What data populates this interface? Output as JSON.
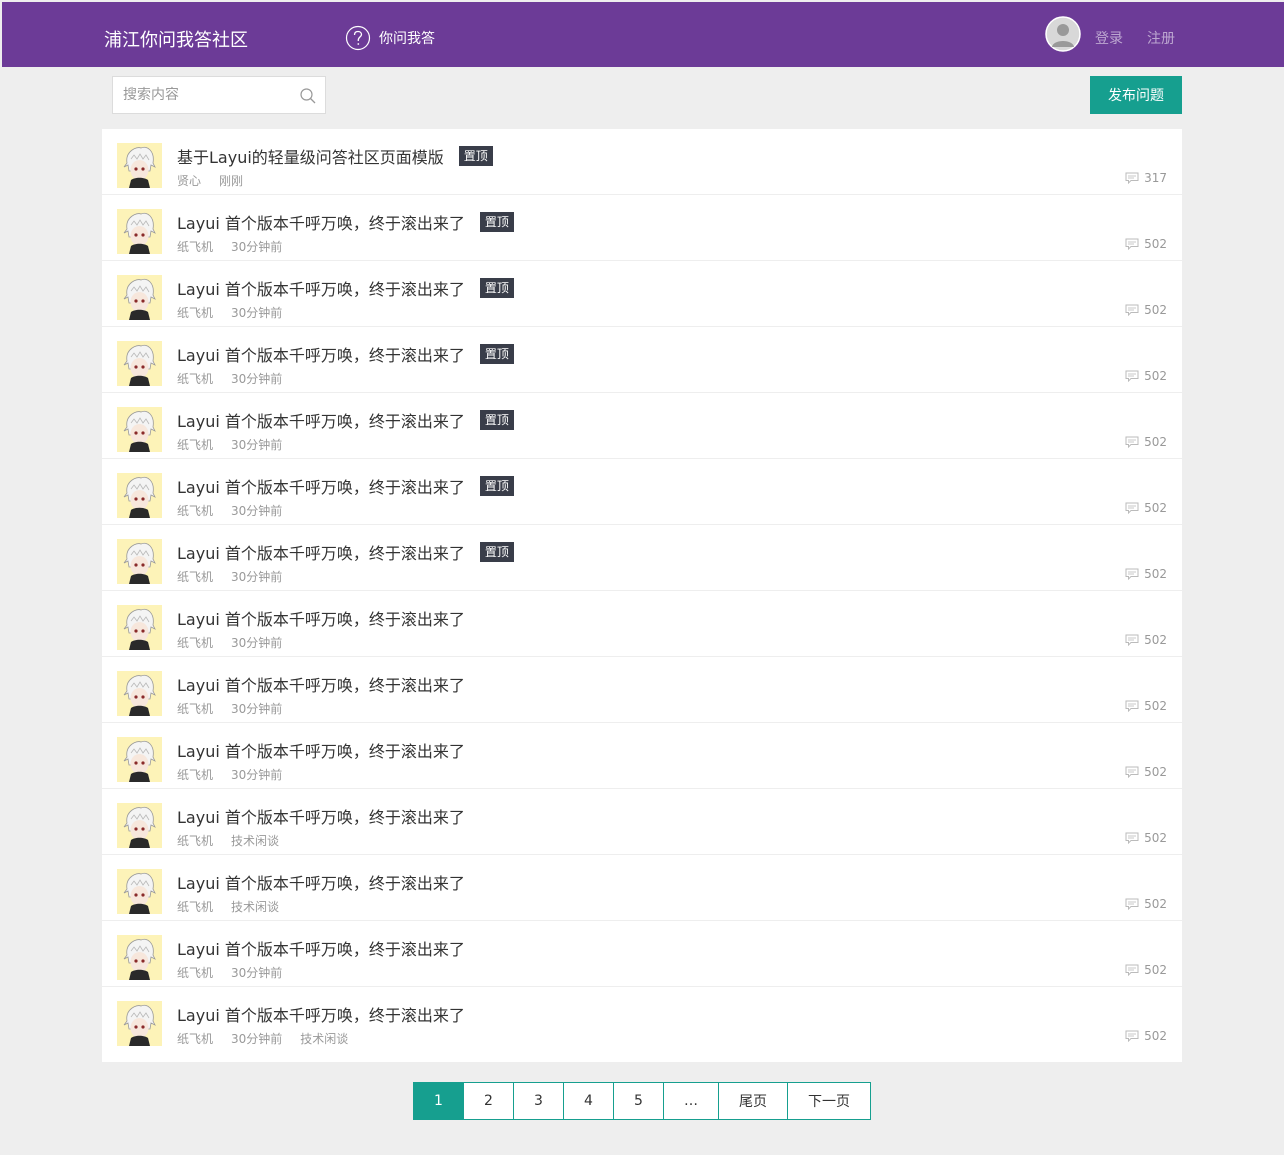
{
  "header": {
    "logo": "浦江你问我答社区",
    "nav_label": "你问我答",
    "login": "登录",
    "register": "注册"
  },
  "search": {
    "placeholder": "搜索内容"
  },
  "publish_label": "发布问题",
  "colors": {
    "header_bg": "#6c3b97",
    "accent": "#169f8f",
    "badge_bg": "#393d49",
    "page_bg": "#eeeeee"
  },
  "items": [
    {
      "title": "基于Layui的轻量级问答社区页面模版",
      "badge": "置顶",
      "meta": [
        "贤心",
        "刚刚"
      ],
      "comments": "317"
    },
    {
      "title": "Layui 首个版本千呼万唤，终于滚出来了",
      "badge": "置顶",
      "meta": [
        "纸飞机",
        "30分钟前"
      ],
      "comments": "502"
    },
    {
      "title": "Layui 首个版本千呼万唤，终于滚出来了",
      "badge": "置顶",
      "meta": [
        "纸飞机",
        "30分钟前"
      ],
      "comments": "502"
    },
    {
      "title": "Layui 首个版本千呼万唤，终于滚出来了",
      "badge": "置顶",
      "meta": [
        "纸飞机",
        "30分钟前"
      ],
      "comments": "502"
    },
    {
      "title": "Layui 首个版本千呼万唤，终于滚出来了",
      "badge": "置顶",
      "meta": [
        "纸飞机",
        "30分钟前"
      ],
      "comments": "502"
    },
    {
      "title": "Layui 首个版本千呼万唤，终于滚出来了",
      "badge": "置顶",
      "meta": [
        "纸飞机",
        "30分钟前"
      ],
      "comments": "502"
    },
    {
      "title": "Layui 首个版本千呼万唤，终于滚出来了",
      "badge": "置顶",
      "meta": [
        "纸飞机",
        "30分钟前"
      ],
      "comments": "502"
    },
    {
      "title": "Layui 首个版本千呼万唤，终于滚出来了",
      "badge": "",
      "meta": [
        "纸飞机",
        "30分钟前"
      ],
      "comments": "502"
    },
    {
      "title": "Layui 首个版本千呼万唤，终于滚出来了",
      "badge": "",
      "meta": [
        "纸飞机",
        "30分钟前"
      ],
      "comments": "502"
    },
    {
      "title": "Layui 首个版本千呼万唤，终于滚出来了",
      "badge": "",
      "meta": [
        "纸飞机",
        "30分钟前"
      ],
      "comments": "502"
    },
    {
      "title": "Layui 首个版本千呼万唤，终于滚出来了",
      "badge": "",
      "meta": [
        "纸飞机",
        "技术闲谈"
      ],
      "comments": "502"
    },
    {
      "title": "Layui 首个版本千呼万唤，终于滚出来了",
      "badge": "",
      "meta": [
        "纸飞机",
        "技术闲谈"
      ],
      "comments": "502"
    },
    {
      "title": "Layui 首个版本千呼万唤，终于滚出来了",
      "badge": "",
      "meta": [
        "纸飞机",
        "30分钟前"
      ],
      "comments": "502"
    },
    {
      "title": "Layui 首个版本千呼万唤，终于滚出来了",
      "badge": "",
      "meta": [
        "纸飞机",
        "30分钟前",
        "技术闲谈"
      ],
      "comments": "502"
    }
  ],
  "pagination": [
    {
      "label": "1",
      "active": true
    },
    {
      "label": "2",
      "active": false
    },
    {
      "label": "3",
      "active": false
    },
    {
      "label": "4",
      "active": false
    },
    {
      "label": "5",
      "active": false
    },
    {
      "label": "…",
      "active": false
    },
    {
      "label": "尾页",
      "active": false
    },
    {
      "label": "下一页",
      "active": false
    }
  ]
}
